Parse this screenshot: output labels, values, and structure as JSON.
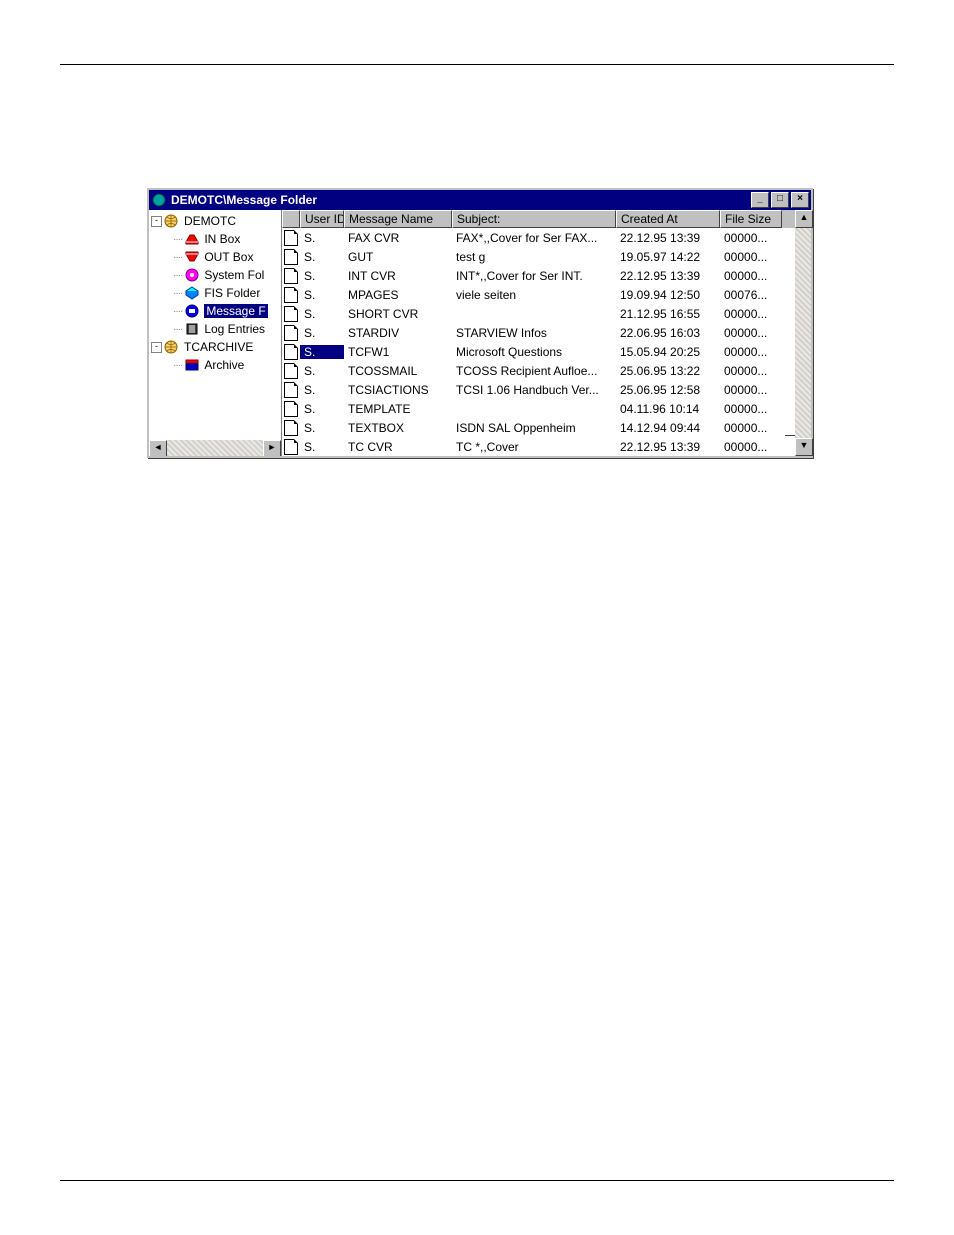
{
  "window": {
    "title": "DEMOTC\\Message Folder"
  },
  "tree": {
    "nodes": [
      {
        "label": "DEMOTC",
        "level": 0,
        "expander": "-",
        "icon": "globe-icon",
        "selected": false
      },
      {
        "label": "IN Box",
        "level": 1,
        "expander": "",
        "icon": "inbox-red-icon",
        "selected": false
      },
      {
        "label": "OUT Box",
        "level": 1,
        "expander": "",
        "icon": "outbox-red-icon",
        "selected": false
      },
      {
        "label": "System Fol",
        "level": 1,
        "expander": "",
        "icon": "system-folder-icon",
        "selected": false
      },
      {
        "label": "FIS Folder",
        "level": 1,
        "expander": "",
        "icon": "fis-folder-icon",
        "selected": false
      },
      {
        "label": "Message F",
        "level": 1,
        "expander": "",
        "icon": "message-folder-icon",
        "selected": true
      },
      {
        "label": "Log Entries",
        "level": 1,
        "expander": "",
        "icon": "log-entries-icon",
        "selected": false
      },
      {
        "label": "TCARCHIVE",
        "level": 0,
        "expander": "-",
        "icon": "globe-icon",
        "selected": false
      },
      {
        "label": "Archive",
        "level": 1,
        "expander": "",
        "icon": "archive-icon",
        "selected": false
      }
    ]
  },
  "columns": {
    "icon": "",
    "user": "User ID",
    "name": "Message Name",
    "subject": "Subject:",
    "created": "Created At",
    "size": "File Size"
  },
  "rows": [
    {
      "user": "S.",
      "name": "FAX    CVR",
      "subject": "FAX*,,Cover for Ser FAX...",
      "created": "22.12.95 13:39",
      "size": "00000...",
      "selected": false
    },
    {
      "user": "S.",
      "name": "GUT",
      "subject": "test g",
      "created": "19.05.97 14:22",
      "size": "00000...",
      "selected": false
    },
    {
      "user": "S.",
      "name": "INT    CVR",
      "subject": "INT*,,Cover for Ser INT.",
      "created": "22.12.95 13:39",
      "size": "00000...",
      "selected": false
    },
    {
      "user": "S.",
      "name": "MPAGES",
      "subject": "viele seiten",
      "created": "19.09.94 12:50",
      "size": "00076...",
      "selected": false
    },
    {
      "user": "S.",
      "name": "SHORT  CVR",
      "subject": "",
      "created": "21.12.95 16:55",
      "size": "00000...",
      "selected": false
    },
    {
      "user": "S.",
      "name": "STARDIV",
      "subject": "STARVIEW Infos",
      "created": "22.06.95 16:03",
      "size": "00000...",
      "selected": false
    },
    {
      "user": "S.",
      "name": "TCFW1",
      "subject": "Microsoft Questions",
      "created": "15.05.94 20:25",
      "size": "00000...",
      "selected": true
    },
    {
      "user": "S.",
      "name": "TCOSSMAIL",
      "subject": "TCOSS Recipient Aufloe...",
      "created": "25.06.95 13:22",
      "size": "00000...",
      "selected": false
    },
    {
      "user": "S.",
      "name": "TCSIACTIONS",
      "subject": "TCSI 1.06 Handbuch Ver...",
      "created": "25.06.95 12:58",
      "size": "00000...",
      "selected": false
    },
    {
      "user": "S.",
      "name": "TEMPLATE",
      "subject": "",
      "created": "04.11.96 10:14",
      "size": "00000...",
      "selected": false
    },
    {
      "user": "S.",
      "name": "TEXTBOX",
      "subject": "ISDN SAL Oppenheim",
      "created": "14.12.94 09:44",
      "size": "00000...",
      "selected": false
    },
    {
      "user": "S.",
      "name": "TC CVR",
      "subject": "TC *,,Cover",
      "created": "22.12.95 13:39",
      "size": "00000...",
      "selected": false
    }
  ]
}
